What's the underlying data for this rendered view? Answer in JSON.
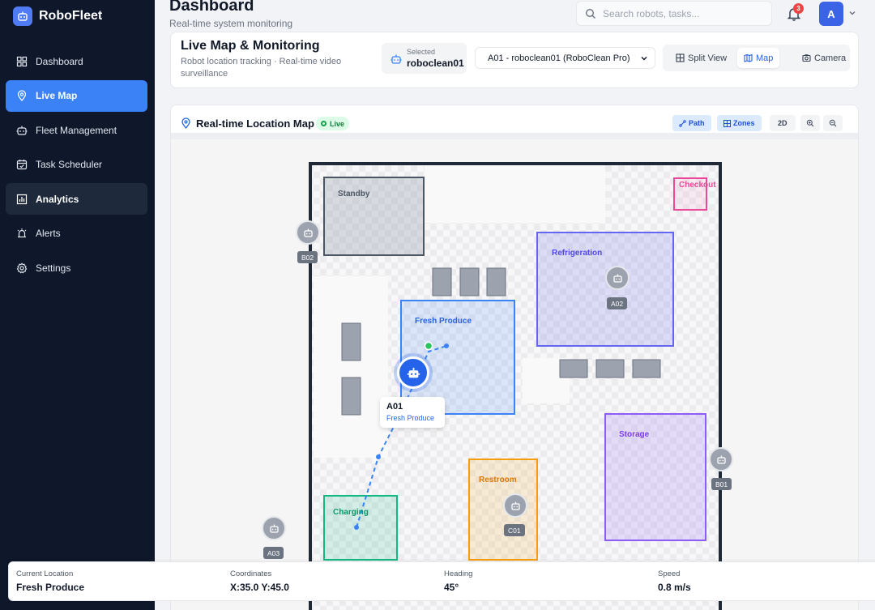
{
  "brand": {
    "name": "RoboFleet"
  },
  "sidebar": {
    "items": [
      {
        "label": "Dashboard",
        "icon": "dashboard-icon"
      },
      {
        "label": "Live Map",
        "icon": "map-pin-icon"
      },
      {
        "label": "Fleet Management",
        "icon": "robot-icon"
      },
      {
        "label": "Task Scheduler",
        "icon": "calendar-icon"
      },
      {
        "label": "Analytics",
        "icon": "bar-chart-icon"
      },
      {
        "label": "Alerts",
        "icon": "alarm-icon"
      },
      {
        "label": "Settings",
        "icon": "gear-icon"
      }
    ]
  },
  "header": {
    "title": "Dashboard",
    "subtitle": "Real-time system monitoring",
    "search_placeholder": "Search robots, tasks...",
    "notification_count": "3",
    "avatar_initial": "A"
  },
  "monitor": {
    "title": "Live Map & Monitoring",
    "description": "Robot location tracking · Real-time video surveillance",
    "selected_label": "Selected",
    "selected_value": "roboclean01",
    "robot_select": "A01 - roboclean01 (RoboClean Pro)",
    "views": {
      "split": "Split View",
      "map": "Map",
      "camera": "Camera"
    }
  },
  "map": {
    "title": "Real-time Location Map",
    "live_label": "Live",
    "tools": {
      "path": "Path",
      "zones": "Zones",
      "mode": "2D"
    },
    "zones": {
      "standby": "Standby",
      "checkout": "Checkout",
      "refrigeration": "Refrigeration",
      "fresh_produce": "Fresh Produce",
      "storage": "Storage",
      "restroom": "Restroom",
      "charging": "Charging"
    },
    "robots": {
      "b02": "B02",
      "a02": "A02",
      "b01": "B01",
      "c01": "C01",
      "a03": "A03"
    },
    "active_robot": {
      "name": "A01",
      "zone": "Fresh Produce"
    }
  },
  "status": {
    "location_label": "Current Location",
    "location_value": "Fresh Produce",
    "coordinates_label": "Coordinates",
    "coordinates_value": "X:35.0 Y:45.0",
    "heading_label": "Heading",
    "heading_value": "45°",
    "speed_label": "Speed",
    "speed_value": "0.8 m/s"
  },
  "colors": {
    "accent": "#3b82f6",
    "sidebar_bg": "#0f172a",
    "standby": "#4b5563",
    "checkout": "#ec4899",
    "refrigeration": "#6366f1",
    "fresh_produce": "#3b82f6",
    "storage": "#8b5cf6",
    "restroom": "#f59e0b",
    "charging": "#10b981"
  }
}
